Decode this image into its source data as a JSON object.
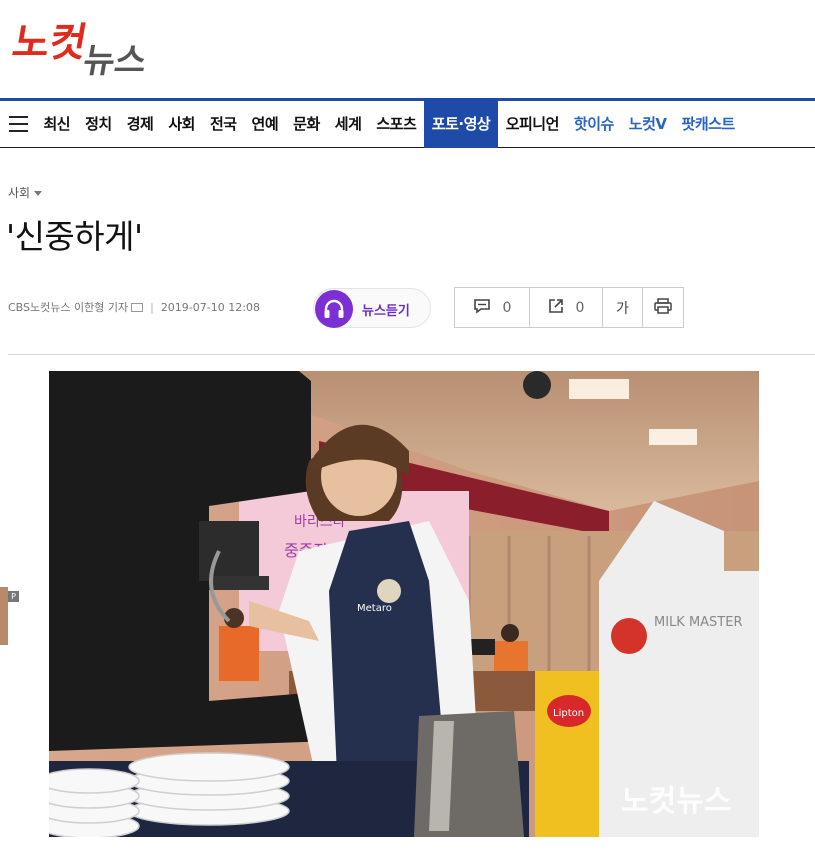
{
  "logo": {
    "text": "노컷뉴스",
    "part1": "노컷",
    "part2": "뉴스"
  },
  "nav": {
    "items": [
      {
        "label": "최신",
        "style": "normal"
      },
      {
        "label": "정치",
        "style": "normal"
      },
      {
        "label": "경제",
        "style": "normal"
      },
      {
        "label": "사회",
        "style": "normal"
      },
      {
        "label": "전국",
        "style": "normal"
      },
      {
        "label": "연예",
        "style": "normal"
      },
      {
        "label": "문화",
        "style": "normal"
      },
      {
        "label": "세계",
        "style": "normal"
      },
      {
        "label": "스포츠",
        "style": "normal"
      },
      {
        "label": "포토·영상",
        "style": "active"
      },
      {
        "label": "오피니언",
        "style": "normal"
      },
      {
        "label": "핫이슈",
        "style": "blue"
      },
      {
        "label": "노컷V",
        "style": "blue"
      },
      {
        "label": "팟캐스트",
        "style": "blue"
      }
    ],
    "accent": "#1e4aa8"
  },
  "article": {
    "category": "사회",
    "title": "'신중하게'",
    "byline": "CBS노컷뉴스 이한형 기자",
    "datetime": "2019-07-10 12:08",
    "listen_label": "뉴스듣기",
    "comment_count": "0",
    "share_count": "0",
    "font_size_label": "가",
    "photo_watermark": "노컷뉴스",
    "side_badge": "P"
  },
  "photo_overlay": {
    "banner_text": "바리스타 세계 중증장애인 바리",
    "apron_text": "Metaro",
    "carton_brand": "MILK MASTER",
    "tea_brand": "Lipton"
  }
}
